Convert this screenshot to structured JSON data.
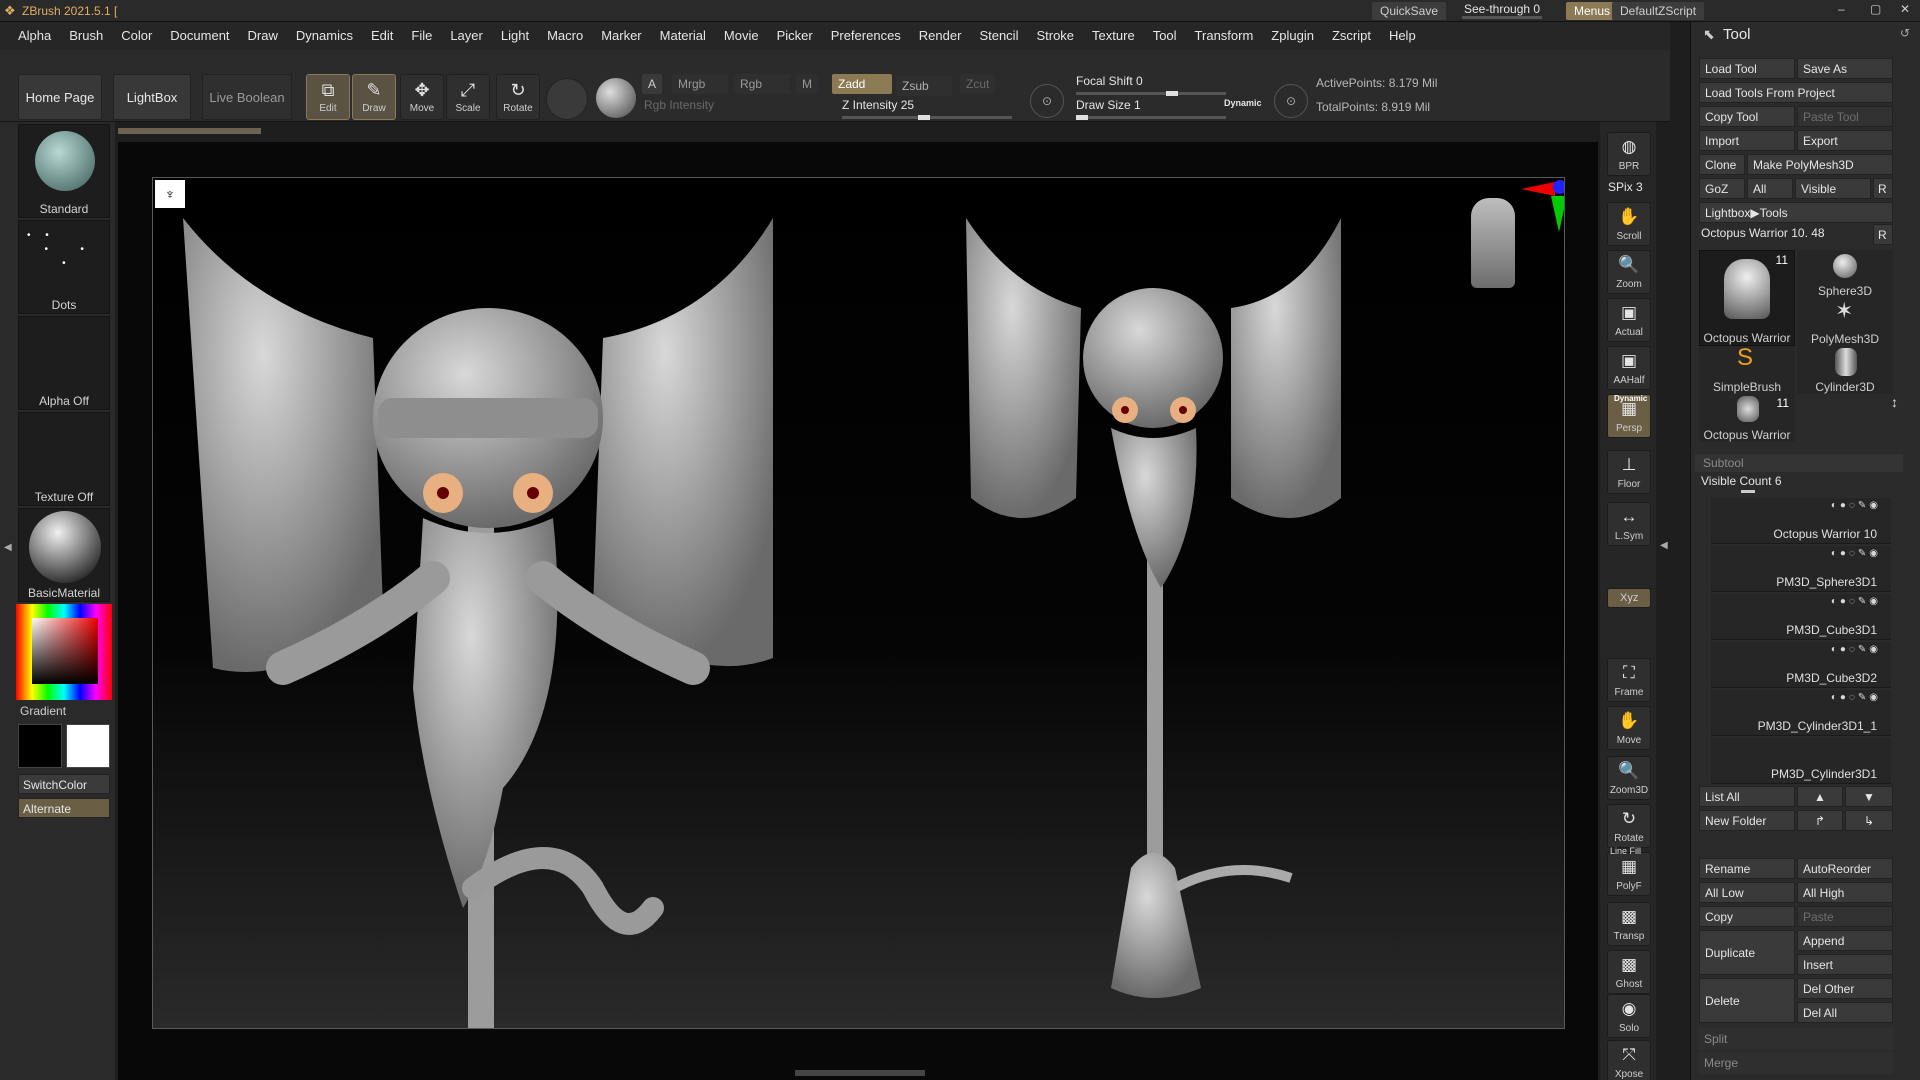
{
  "titlebar": {
    "app_title": "ZBrush 2021.5.1 [",
    "quicksave": "QuickSave",
    "seethrough": "See-through  0",
    "menus": "Menus",
    "defaultzscript": "DefaultZScript"
  },
  "menubar": [
    "Alpha",
    "Brush",
    "Color",
    "Document",
    "Draw",
    "Dynamics",
    "Edit",
    "File",
    "Layer",
    "Light",
    "Macro",
    "Marker",
    "Material",
    "Movie",
    "Picker",
    "Preferences",
    "Render",
    "Stencil",
    "Stroke",
    "Texture",
    "Tool",
    "Transform",
    "Zplugin",
    "Zscript",
    "Help"
  ],
  "shelf": {
    "home_page": "Home Page",
    "lightbox": "LightBox",
    "live_boolean": "Live Boolean",
    "edit": "Edit",
    "draw": "Draw",
    "move": "Move",
    "scale": "Scale",
    "rotate": "Rotate",
    "a": "A",
    "mrgb": "Mrgb",
    "rgb": "Rgb",
    "m": "M",
    "zadd": "Zadd",
    "zsub": "Zsub",
    "zcut": "Zcut",
    "rgb_intensity": "Rgb Intensity",
    "z_intensity": "Z Intensity 25",
    "focal_shift": "Focal Shift 0",
    "draw_size": "Draw Size 1",
    "dynamic": "Dynamic",
    "active_points": "ActivePoints: 8.179 Mil",
    "total_points": "TotalPoints: 8.919 Mil"
  },
  "leftshelf": {
    "brush": "Standard",
    "stroke": "Dots",
    "alpha": "Alpha Off",
    "texture": "Texture Off",
    "material": "BasicMaterial",
    "gradient": "Gradient",
    "switchcolor": "SwitchColor",
    "alternate": "Alternate"
  },
  "rightcol": [
    "BPR",
    "SPix 3",
    "Scroll",
    "Zoom",
    "Actual",
    "AAHalf",
    "Persp",
    "Floor",
    "L.Sym",
    "",
    "Xyz",
    "",
    "",
    "Frame",
    "Move",
    "Zoom3D",
    "Rotate",
    "PolyF",
    "Transp",
    "Ghost",
    "Solo",
    "Xpose"
  ],
  "rightcol_extra": {
    "dynamic": "Dynamic",
    "line_fill": "Line Fill"
  },
  "toolpanel": {
    "title": "Tool",
    "load_tool": "Load Tool",
    "save_as": "Save As",
    "load_from_project": "Load Tools From Project",
    "copy_tool": "Copy Tool",
    "paste_tool": "Paste Tool",
    "import": "Import",
    "export": "Export",
    "clone": "Clone",
    "make_polymesh": "Make PolyMesh3D",
    "goz": "GoZ",
    "all": "All",
    "visible": "Visible",
    "r": "R",
    "lightbox_tools": "Lightbox▶Tools",
    "current_tool": "Octopus Warrior 10. 48",
    "thumbs": [
      {
        "label": "Octopus Warrior",
        "count": "11"
      },
      {
        "label": "Sphere3D",
        "count": ""
      },
      {
        "label": "PolyMesh3D",
        "count": ""
      },
      {
        "label": "SimpleBrush",
        "count": ""
      },
      {
        "label": "Cylinder3D",
        "count": ""
      },
      {
        "label": "Octopus Warrior",
        "count": "11"
      }
    ],
    "subtool_header": "Subtool",
    "visible_count": "Visible Count 6",
    "subtools": [
      "Octopus Warrior 10",
      "PM3D_Sphere3D1",
      "PM3D_Cube3D1",
      "PM3D_Cube3D2",
      "PM3D_Cylinder3D1_1",
      "PM3D_Cylinder3D1"
    ],
    "list_all": "List All",
    "new_folder": "New Folder",
    "rename": "Rename",
    "autoreorder": "AutoReorder",
    "all_low": "All Low",
    "all_high": "All High",
    "copy": "Copy",
    "paste": "Paste",
    "duplicate": "Duplicate",
    "append": "Append",
    "insert": "Insert",
    "delete": "Delete",
    "del_other": "Del Other",
    "del_all": "Del All",
    "split": "Split",
    "merge": "Merge"
  },
  "colors": {
    "accent": "#8c7a55",
    "bg": "#2b2b2b",
    "canvas": "#000000"
  }
}
